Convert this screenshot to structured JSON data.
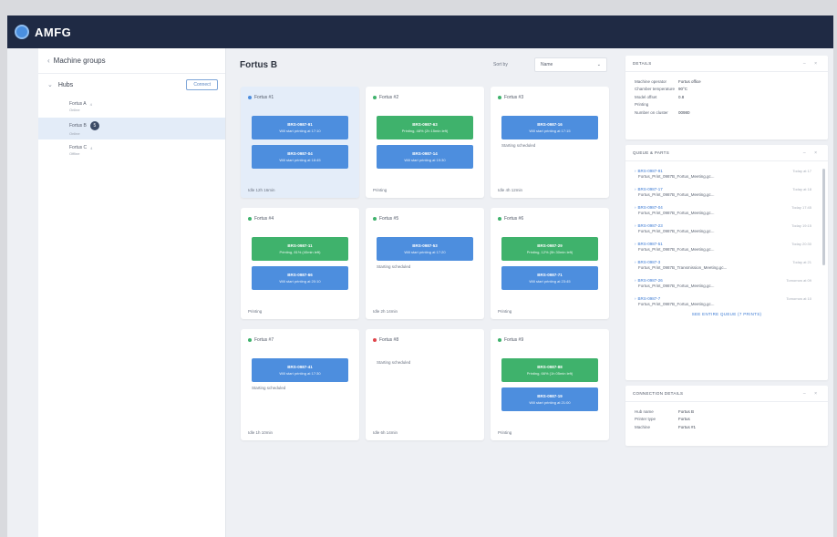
{
  "topbar": {
    "logo_text": "AMFG",
    "logo_sub": ""
  },
  "sidebar": {
    "title": "Machine groups",
    "group": {
      "name": "Hubs",
      "button": "Connect"
    },
    "items": [
      {
        "label": "Fortus A",
        "count": "4",
        "sub": "Online",
        "badge": ""
      },
      {
        "label": "Fortus B",
        "count": "",
        "sub": "Online",
        "badge": "5"
      },
      {
        "label": "Fortus C",
        "count": "4",
        "sub": "Offline",
        "badge": ""
      }
    ]
  },
  "main": {
    "title": "Fortus B",
    "sort_label": "Sort by",
    "sort_value": "Name"
  },
  "colors": {
    "blue": "#4d8ede",
    "green": "#3fb26c",
    "red": "#e0454b",
    "topbar": "#1f2a44"
  },
  "cards": [
    {
      "name": "Fortus #1",
      "dot": "#4d8ede",
      "selected": true,
      "jobs": [
        {
          "color": "#4d8ede",
          "j1": "BRS-0987-91",
          "j2": "Will start printing at 17:10"
        },
        {
          "color": "#4d8ede",
          "j1": "BRS-0987-04",
          "j2": "Will start printing at 18:45"
        }
      ],
      "status": "",
      "foot": "Idle 12h 16min"
    },
    {
      "name": "Fortus #2",
      "dot": "#3fb26c",
      "selected": false,
      "jobs": [
        {
          "color": "#3fb26c",
          "j1": "BRS-0987-63",
          "j2": "Printing, 48% (2h 15min left)"
        },
        {
          "color": "#4d8ede",
          "j1": "BRS-0987-14",
          "j2": "Will start printing at 19:30"
        }
      ],
      "status": "",
      "foot": "Printing"
    },
    {
      "name": "Fortus #3",
      "dot": "#3fb26c",
      "selected": false,
      "jobs": [
        {
          "color": "#4d8ede",
          "j1": "BRS-0987-16",
          "j2": "Will start printing at 17:15"
        }
      ],
      "status": "Starting scheduled",
      "foot": "Idle 4h 12min"
    },
    {
      "name": "Fortus #4",
      "dot": "#3fb26c",
      "selected": false,
      "jobs": [
        {
          "color": "#3fb26c",
          "j1": "BRS-0987-11",
          "j2": "Printing, 81% (40min left)"
        },
        {
          "color": "#4d8ede",
          "j1": "BRS-0987-66",
          "j2": "Will start printing at 20:10"
        }
      ],
      "status": "",
      "foot": "Printing"
    },
    {
      "name": "Fortus #5",
      "dot": "#3fb26c",
      "selected": false,
      "jobs": [
        {
          "color": "#4d8ede",
          "j1": "BRS-0987-53",
          "j2": "Will start printing at 17:20"
        }
      ],
      "status": "Starting scheduled",
      "foot": "Idle 2h 14min"
    },
    {
      "name": "Fortus #6",
      "dot": "#3fb26c",
      "selected": false,
      "jobs": [
        {
          "color": "#3fb26c",
          "j1": "BRS-0987-29",
          "j2": "Printing, 12% (5h 30min left)"
        },
        {
          "color": "#4d8ede",
          "j1": "BRS-0987-71",
          "j2": "Will start printing at 23:45"
        }
      ],
      "status": "",
      "foot": "Printing"
    },
    {
      "name": "Fortus #7",
      "dot": "#3fb26c",
      "selected": false,
      "jobs": [
        {
          "color": "#4d8ede",
          "j1": "BRS-0987-41",
          "j2": "Will start printing at 17:30"
        }
      ],
      "status": "Starting scheduled",
      "foot": "Idle 1h 10min"
    },
    {
      "name": "Fortus #8",
      "dot": "#e0454b",
      "selected": false,
      "jobs": [],
      "status": "Starting scheduled",
      "foot": "Idle 6h 14min"
    },
    {
      "name": "Fortus #9",
      "dot": "#3fb26c",
      "selected": false,
      "jobs": [
        {
          "color": "#3fb26c",
          "j1": "BRS-0987-88",
          "j2": "Printing, 66% (1h 05min left)"
        },
        {
          "color": "#4d8ede",
          "j1": "BRS-0987-19",
          "j2": "Will start printing at 21:00"
        }
      ],
      "status": "",
      "foot": "Printing"
    }
  ],
  "details": {
    "title": "DETAILS",
    "rows": [
      {
        "k": "Machine operator",
        "v": "Fortus office"
      },
      {
        "k": "Chamber temperature",
        "v": "90°C"
      },
      {
        "k": "Model offset",
        "v": "0.8"
      },
      {
        "k": "Printing",
        "v": ""
      },
      {
        "k": "Number on cluster",
        "v": "00980"
      }
    ]
  },
  "queue": {
    "title": "QUEUE & PARTS",
    "items": [
      {
        "id": "BRS-0987-91",
        "file": "Fortus_Print_0987B_Fortus_Meeting.gc...",
        "time": "Today at 17"
      },
      {
        "id": "BRS-0987-17",
        "file": "Fortus_Print_0987B_Fortus_Meeting.gc...",
        "time": "Today at 18"
      },
      {
        "id": "BRS-0987-04",
        "file": "Fortus_Print_0987B_Fortus_Meeting.gc...",
        "time": "Today 17:45"
      },
      {
        "id": "BRS-0987-23",
        "file": "Fortus_Print_0987B_Fortus_Meeting.gc...",
        "time": "Today 19:15"
      },
      {
        "id": "BRS-0987-51",
        "file": "Fortus_Print_0987B_Fortus_Meeting.gc...",
        "time": "Today 20:30"
      },
      {
        "id": "BRS-0987-3",
        "file": "Fortus_Print_0987B_Transmission_Meeting.gc...",
        "time": "Today at 21"
      },
      {
        "id": "BRS-0987-26",
        "file": "Fortus_Print_0987B_Fortus_Meeting.gc...",
        "time": "Tomorrow at 09"
      },
      {
        "id": "BRS-0987-7",
        "file": "Fortus_Print_0987B_Fortus_Meeting.gc...",
        "time": "Tomorrow at 10"
      }
    ],
    "more": "SEE ENTIRE QUEUE (7 PRINTS)"
  },
  "connection": {
    "title": "CONNECTION DETAILS",
    "rows": [
      {
        "k": "Hub name",
        "v": "Fortus B"
      },
      {
        "k": "Printer type",
        "v": "Fortus"
      },
      {
        "k": "Machine",
        "v": "Fortus #1"
      }
    ]
  }
}
